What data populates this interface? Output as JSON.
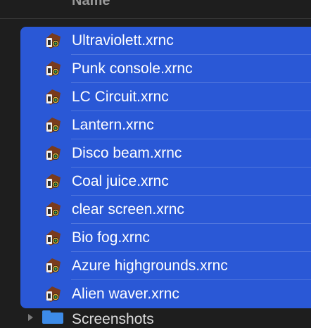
{
  "header": {
    "name_column": "Name"
  },
  "files": [
    {
      "label": "Ultraviolett.xrnc",
      "icon": "renoise-song-icon"
    },
    {
      "label": "Punk console.xrnc",
      "icon": "renoise-song-icon"
    },
    {
      "label": "LC Circuit.xrnc",
      "icon": "renoise-song-icon"
    },
    {
      "label": "Lantern.xrnc",
      "icon": "renoise-song-icon"
    },
    {
      "label": "Disco beam.xrnc",
      "icon": "renoise-song-icon"
    },
    {
      "label": "Coal juice.xrnc",
      "icon": "renoise-song-icon"
    },
    {
      "label": "clear screen.xrnc",
      "icon": "renoise-song-icon"
    },
    {
      "label": "Bio fog.xrnc",
      "icon": "renoise-song-icon"
    },
    {
      "label": "Azure highgrounds.xrnc",
      "icon": "renoise-song-icon"
    },
    {
      "label": "Alien waver.xrnc",
      "icon": "renoise-song-icon"
    }
  ],
  "next_item": {
    "label": "Screenshots",
    "icon": "folder-icon"
  },
  "colors": {
    "selection": "#2a58d6",
    "background": "#1e1e1e",
    "text": "#ffffff"
  }
}
